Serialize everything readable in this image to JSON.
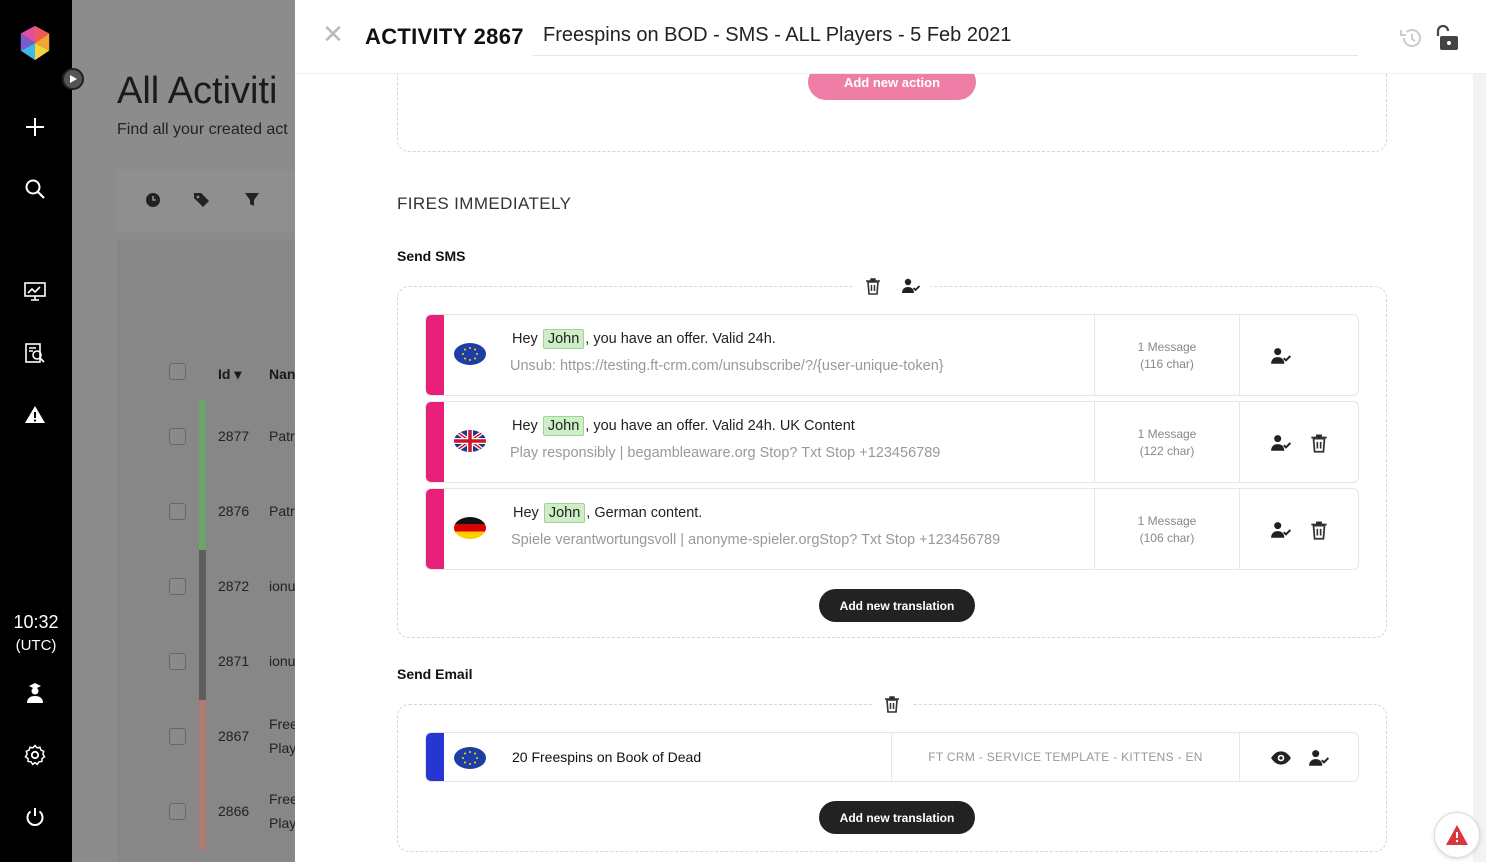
{
  "sidebar": {
    "clock_time": "10:32",
    "clock_zone": "(UTC)"
  },
  "background_page": {
    "title": "All Activiti",
    "subtitle": "Find all your created act",
    "columns": {
      "id": "Id",
      "name": "Nan"
    },
    "rows": [
      {
        "id": "2877",
        "name": [
          "Patr"
        ],
        "bar_color": "#6fa36a"
      },
      {
        "id": "2876",
        "name": [
          "Patr"
        ],
        "bar_color": "#6fa36a"
      },
      {
        "id": "2872",
        "name": [
          "ionu"
        ],
        "bar_color": "#5e5e5e"
      },
      {
        "id": "2871",
        "name": [
          "ionu"
        ],
        "bar_color": "#5e5e5e"
      },
      {
        "id": "2867",
        "name": [
          "Free",
          "Play"
        ],
        "bar_color": "#b07a72"
      },
      {
        "id": "2866",
        "name": [
          "Free",
          "Play"
        ],
        "bar_color": "#b07a72"
      }
    ]
  },
  "drawer": {
    "activity_label": "ACTIVITY 2867",
    "activity_name": "Freespins on BOD - SMS - ALL Players - 5 Feb 2021",
    "add_action_label": "Add new action",
    "section_title": "FIRES IMMEDIATELY",
    "sms": {
      "title": "Send SMS",
      "translations": [
        {
          "flag": "eu-flag-icon",
          "pre": "Hey",
          "name": "John",
          "post": ", you have an offer. Valid 24h.",
          "footer": "Unsub: https://testing.ft-crm.com/unsubscribe/?/{user-unique-token}",
          "count": "1 Message",
          "chars": "(116 char)",
          "deletable": false
        },
        {
          "flag": "uk-flag-icon",
          "pre": "Hey",
          "name": "John",
          "post": ", you have an offer. Valid 24h. UK Content",
          "footer": "Play responsibly | begambleaware.org Stop? Txt Stop +123456789",
          "count": "1 Message",
          "chars": "(122 char)",
          "deletable": true
        },
        {
          "flag": "de-flag-icon",
          "pre": "Hey",
          "name": "John",
          "post": ", German content.",
          "footer": "Spiele verantwortungsvoll | anonyme-spieler.orgStop? Txt Stop +123456789",
          "count": "1 Message",
          "chars": "(106 char)",
          "deletable": true
        }
      ],
      "add_translation_label": "Add new translation"
    },
    "email": {
      "title": "Send Email",
      "translations": [
        {
          "flag": "eu-flag-icon",
          "subject": "20 Freespins on Book of Dead",
          "template": "FT CRM - SERVICE TEMPLATE - KITTENS - EN"
        }
      ],
      "add_translation_label": "Add new translation"
    }
  },
  "colors": {
    "accent_pink": "#ef7ea6",
    "sms_stripe": "#e8207a",
    "email_stripe": "#2735d3",
    "highlight_bg": "#cdeec6"
  }
}
